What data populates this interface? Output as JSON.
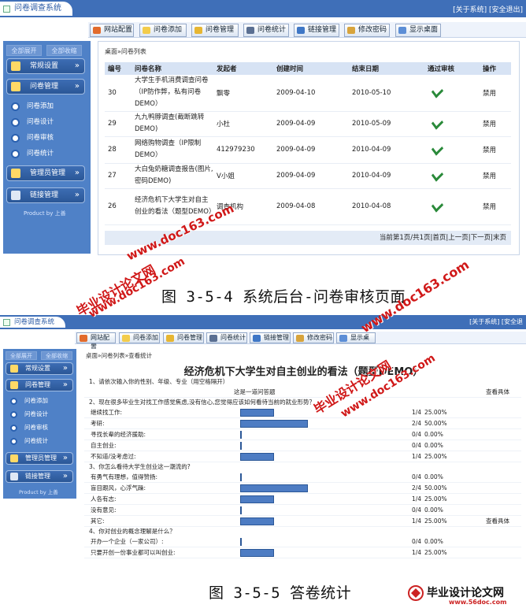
{
  "screen1": {
    "window_title": "问卷调查系统",
    "top_links": "[关于系统] [安全退出]",
    "nav": [
      "网站配置",
      "问卷添加",
      "问卷管理",
      "问卷统计",
      "链接管理",
      "修改密码",
      "显示桌面"
    ],
    "side_toggle": [
      "全部展开",
      "全部收缩"
    ],
    "menu": {
      "settings": "常规设置",
      "survey": "问卷管理",
      "survey_items": [
        "问卷添加",
        "问卷设计",
        "问卷审核",
        "问卷统计"
      ],
      "admin": "管理员管理",
      "links": "链接管理"
    },
    "product_by": "Product by 上善",
    "breadcrumb": "桌面»问卷列表",
    "table": {
      "headers": [
        "编号",
        "问卷名称",
        "发起者",
        "创建时间",
        "结束日期",
        "通过审核",
        "操作"
      ],
      "rows": [
        {
          "id": "30",
          "name": "大学生手机消费调查问卷（IP防作弊，私有问卷DEMO）",
          "owner": "飘零",
          "created": "2009-04-10",
          "end": "2010-05-10",
          "op": "禁用"
        },
        {
          "id": "29",
          "name": "九九鸭脖调查(截断跳转DEMO)",
          "owner": "小杜",
          "created": "2009-04-09",
          "end": "2010-05-09",
          "op": "禁用"
        },
        {
          "id": "28",
          "name": "网络购物调查（IP限制DEMO）",
          "owner": "412979230",
          "created": "2009-04-09",
          "end": "2010-04-09",
          "op": "禁用"
        },
        {
          "id": "27",
          "name": "大白兔奶糖调查报告(图片,密码DEMO)",
          "owner": "V小姐",
          "created": "2009-04-09",
          "end": "2010-04-09",
          "op": "禁用"
        },
        {
          "id": "26",
          "name": "经济危机下大学生对自主创业的看法（题型DEMO）",
          "owner": "调查机构",
          "created": "2009-04-08",
          "end": "2010-04-08",
          "op": "禁用"
        }
      ]
    },
    "pager": "当前第1页/共1页|首页|上一页|下一页|末页"
  },
  "caption1": "图 3-5-4 系统后台-问卷审核页面",
  "screen2": {
    "window_title": "问卷调查系统",
    "top_links": "[关于系统] [安全退",
    "nav": [
      "网站配置",
      "问卷添加",
      "问卷管理",
      "问卷统计",
      "链接管理",
      "修改密码",
      "显示桌"
    ],
    "breadcrumb": "桌面»问卷列表»查看统计",
    "survey_title": "经济危机下大学生对自主创业的看法（题型DEMO）",
    "questions": [
      {
        "q": "1、请依次输入你的性别、年级、专业（用空格隔开）",
        "rows": [
          {
            "label": "这是一道问答题",
            "view": "查看具体"
          }
        ]
      },
      {
        "q": "2、现在很多毕业生对找工作感觉焦虑,没有信心,您觉得应该如何看待当前的就业形势？",
        "rows": [
          {
            "label": "继续找工作:",
            "count": "1/4",
            "pct": "25.00%",
            "v": 0.25
          },
          {
            "label": "考研:",
            "count": "2/4",
            "pct": "50.00%",
            "v": 0.5
          },
          {
            "label": "寻找长辈的经济援助:",
            "count": "0/4",
            "pct": "0.00%",
            "v": 0
          },
          {
            "label": "自主创业:",
            "count": "0/4",
            "pct": "0.00%",
            "v": 0
          },
          {
            "label": "不知道/没考虑过:",
            "count": "1/4",
            "pct": "25.00%",
            "v": 0.25
          }
        ]
      },
      {
        "q": "3、你怎么看待大学生创业这一潮流的?",
        "rows": [
          {
            "label": "有勇气有理想，值得赞扬:",
            "count": "0/4",
            "pct": "0.00%",
            "v": 0
          },
          {
            "label": "盲目跟风，心浮气躁:",
            "count": "2/4",
            "pct": "50.00%",
            "v": 0.5
          },
          {
            "label": "人各有志:",
            "count": "1/4",
            "pct": "25.00%",
            "v": 0.25
          },
          {
            "label": "没有意见:",
            "count": "0/4",
            "pct": "0.00%",
            "v": 0
          },
          {
            "label": "其它:",
            "count": "1/4",
            "pct": "25.00%",
            "v": 0.25,
            "view": "查看具体"
          }
        ]
      },
      {
        "q": "4、你对创业的概念理解是什么？",
        "rows": [
          {
            "label": "开办一个企业（一家公司）:",
            "count": "0/4",
            "pct": "0.00%",
            "v": 0
          },
          {
            "label": "只要开创一份事业都可以叫创业:",
            "count": "1/4",
            "pct": "25.00%",
            "v": 0.25
          }
        ]
      }
    ]
  },
  "caption2": "图 3-5-5 答卷统计",
  "watermarks": [
    "毕业设计论文网",
    "www.doc163.com",
    "www.56doc.com"
  ],
  "colors": {
    "accent": "#3f6fb8",
    "sidebar": "#4f81c7",
    "watermark": "#d01818",
    "bar": "#4d7cc3"
  }
}
